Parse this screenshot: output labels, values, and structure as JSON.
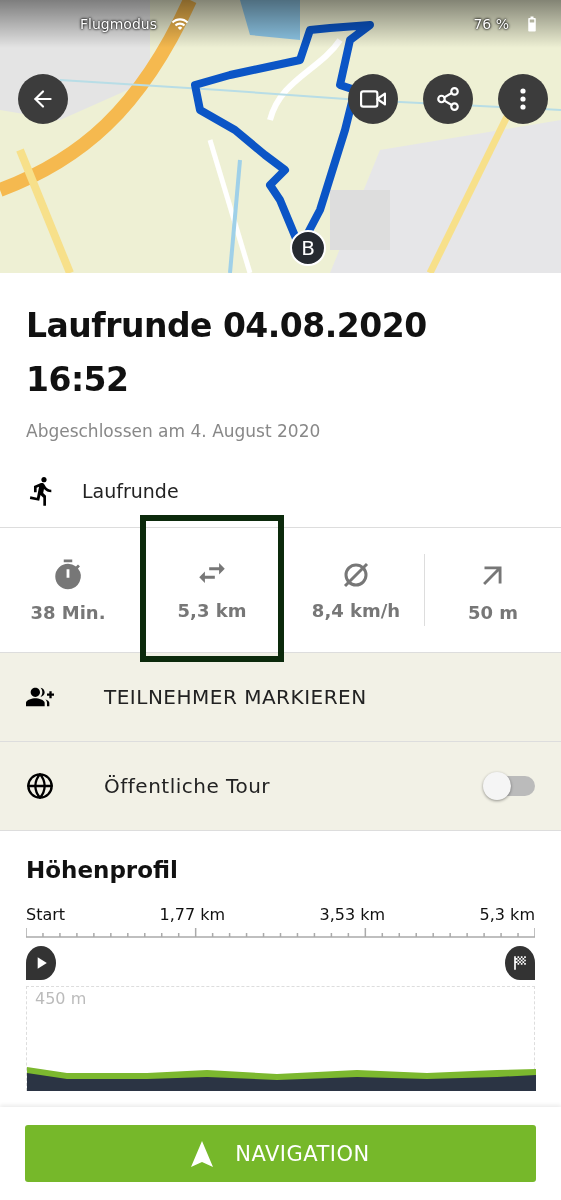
{
  "status_bar": {
    "mode": "Flugmodus",
    "battery": "76 %"
  },
  "map": {
    "end_marker": "B"
  },
  "title": "Laufrunde 04.08.2020 16:52",
  "subtitle": "Abgeschlossen am 4. August 2020",
  "activity": {
    "label": "Laufrunde"
  },
  "stats": [
    {
      "kind": "duration",
      "value": "38 Min.",
      "selected": false
    },
    {
      "kind": "distance",
      "value": "5,3 km",
      "selected": true
    },
    {
      "kind": "speed",
      "value": "8,4 km/h",
      "selected": false
    },
    {
      "kind": "ascent",
      "value": "50 m",
      "selected": false
    }
  ],
  "actions": [
    {
      "kind": "participants",
      "label": "TEILNEHMER MARKIEREN"
    },
    {
      "kind": "public",
      "label": "Öffentliche Tour",
      "on": false
    }
  ],
  "profile": {
    "heading": "Höhenprofil",
    "axis_labels": [
      "Start",
      "1,77 km",
      "3,53 km",
      "5,3 km"
    ],
    "top_label": "450 m"
  },
  "navigation_button": "NAVIGATION"
}
